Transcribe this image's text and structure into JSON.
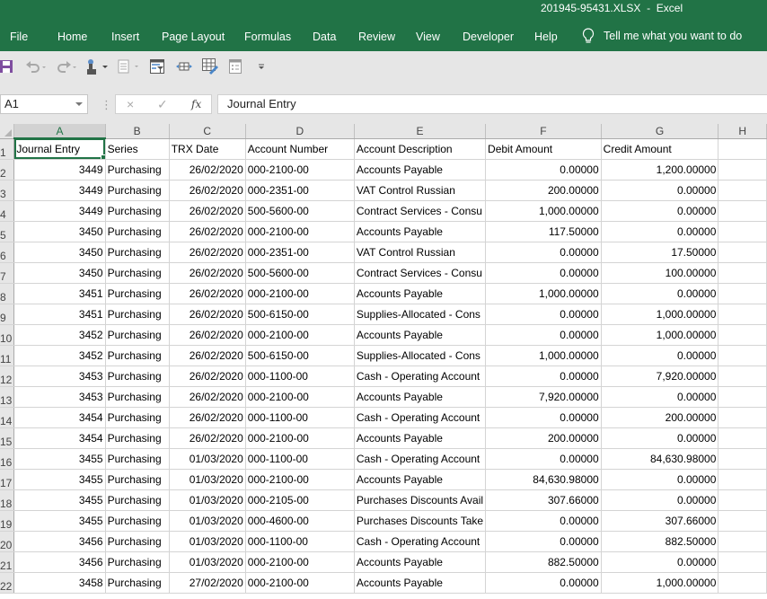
{
  "window": {
    "title": "201945-95431.XLSX  -  Excel"
  },
  "colors": {
    "brand": "#217346",
    "ribbon_bg": "#e6e6e6",
    "gridline": "#d4d4d4"
  },
  "ribbon": {
    "tabs": [
      {
        "label": "File"
      },
      {
        "label": "Home"
      },
      {
        "label": "Insert"
      },
      {
        "label": "Page Layout"
      },
      {
        "label": "Formulas"
      },
      {
        "label": "Data"
      },
      {
        "label": "Review"
      },
      {
        "label": "View"
      },
      {
        "label": "Developer"
      },
      {
        "label": "Help"
      }
    ],
    "tell_me": {
      "icon": "lightbulb-icon",
      "label": "Tell me what you want to do"
    }
  },
  "quick_access": {
    "icons": [
      "save-icon",
      "undo-icon",
      "redo-icon",
      "touch-mode-icon",
      "form-icon",
      "filter-icon",
      "column-width-icon",
      "format-table-icon",
      "form-controls-icon",
      "customize-qat-icon"
    ]
  },
  "formula_bar": {
    "name_box": "A1",
    "cancel_icon": "×",
    "enter_icon": "✓",
    "fx_label": "fx",
    "value": "Journal Entry"
  },
  "sheet": {
    "columns": [
      "A",
      "B",
      "C",
      "D",
      "E",
      "F",
      "G",
      "H"
    ],
    "selected_column": "A",
    "active_cell": "A1",
    "header_row": [
      "Journal Entry",
      "Series",
      "TRX Date",
      "Account Number",
      "Account Description",
      "Debit Amount",
      "Credit Amount",
      ""
    ],
    "rows": [
      {
        "n": "2",
        "cells": [
          "3449",
          "Purchasing",
          "26/02/2020",
          "000-2100-00",
          "Accounts Payable",
          "0.00000",
          "1,200.00000"
        ]
      },
      {
        "n": "3",
        "cells": [
          "3449",
          "Purchasing",
          "26/02/2020",
          "000-2351-00",
          "VAT Control Russian",
          "200.00000",
          "0.00000"
        ]
      },
      {
        "n": "4",
        "cells": [
          "3449",
          "Purchasing",
          "26/02/2020",
          "500-5600-00",
          "Contract Services - Consu",
          "1,000.00000",
          "0.00000"
        ]
      },
      {
        "n": "5",
        "cells": [
          "3450",
          "Purchasing",
          "26/02/2020",
          "000-2100-00",
          "Accounts Payable",
          "117.50000",
          "0.00000"
        ]
      },
      {
        "n": "6",
        "cells": [
          "3450",
          "Purchasing",
          "26/02/2020",
          "000-2351-00",
          "VAT Control Russian",
          "0.00000",
          "17.50000"
        ]
      },
      {
        "n": "7",
        "cells": [
          "3450",
          "Purchasing",
          "26/02/2020",
          "500-5600-00",
          "Contract Services - Consu",
          "0.00000",
          "100.00000"
        ]
      },
      {
        "n": "8",
        "cells": [
          "3451",
          "Purchasing",
          "26/02/2020",
          "000-2100-00",
          "Accounts Payable",
          "1,000.00000",
          "0.00000"
        ]
      },
      {
        "n": "9",
        "cells": [
          "3451",
          "Purchasing",
          "26/02/2020",
          "500-6150-00",
          "Supplies-Allocated - Cons",
          "0.00000",
          "1,000.00000"
        ]
      },
      {
        "n": "10",
        "cells": [
          "3452",
          "Purchasing",
          "26/02/2020",
          "000-2100-00",
          "Accounts Payable",
          "0.00000",
          "1,000.00000"
        ]
      },
      {
        "n": "11",
        "cells": [
          "3452",
          "Purchasing",
          "26/02/2020",
          "500-6150-00",
          "Supplies-Allocated - Cons",
          "1,000.00000",
          "0.00000"
        ]
      },
      {
        "n": "12",
        "cells": [
          "3453",
          "Purchasing",
          "26/02/2020",
          "000-1100-00",
          "Cash - Operating Account",
          "0.00000",
          "7,920.00000"
        ]
      },
      {
        "n": "13",
        "cells": [
          "3453",
          "Purchasing",
          "26/02/2020",
          "000-2100-00",
          "Accounts Payable",
          "7,920.00000",
          "0.00000"
        ]
      },
      {
        "n": "14",
        "cells": [
          "3454",
          "Purchasing",
          "26/02/2020",
          "000-1100-00",
          "Cash - Operating Account",
          "0.00000",
          "200.00000"
        ]
      },
      {
        "n": "15",
        "cells": [
          "3454",
          "Purchasing",
          "26/02/2020",
          "000-2100-00",
          "Accounts Payable",
          "200.00000",
          "0.00000"
        ]
      },
      {
        "n": "16",
        "cells": [
          "3455",
          "Purchasing",
          "01/03/2020",
          "000-1100-00",
          "Cash - Operating Account",
          "0.00000",
          "84,630.98000"
        ]
      },
      {
        "n": "17",
        "cells": [
          "3455",
          "Purchasing",
          "01/03/2020",
          "000-2100-00",
          "Accounts Payable",
          "84,630.98000",
          "0.00000"
        ]
      },
      {
        "n": "18",
        "cells": [
          "3455",
          "Purchasing",
          "01/03/2020",
          "000-2105-00",
          "Purchases Discounts Avail",
          "307.66000",
          "0.00000"
        ]
      },
      {
        "n": "19",
        "cells": [
          "3455",
          "Purchasing",
          "01/03/2020",
          "000-4600-00",
          "Purchases Discounts Take",
          "0.00000",
          "307.66000"
        ]
      },
      {
        "n": "20",
        "cells": [
          "3456",
          "Purchasing",
          "01/03/2020",
          "000-1100-00",
          "Cash - Operating Account",
          "0.00000",
          "882.50000"
        ]
      },
      {
        "n": "21",
        "cells": [
          "3456",
          "Purchasing",
          "01/03/2020",
          "000-2100-00",
          "Accounts Payable",
          "882.50000",
          "0.00000"
        ]
      },
      {
        "n": "22",
        "cells": [
          "3458",
          "Purchasing",
          "27/02/2020",
          "000-2100-00",
          "Accounts Payable",
          "0.00000",
          "1,000.00000"
        ]
      }
    ]
  }
}
